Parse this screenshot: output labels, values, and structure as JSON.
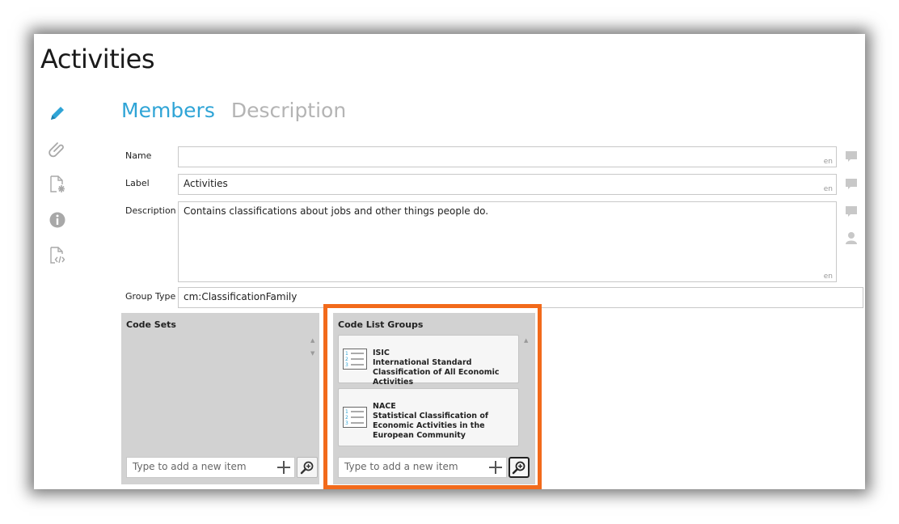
{
  "page": {
    "title": "Activities"
  },
  "sidebar": {
    "icons": [
      "pencil-icon",
      "paperclip-icon",
      "document-asterisk-icon",
      "info-icon",
      "document-code-icon"
    ]
  },
  "tabs": [
    {
      "label": "Members",
      "active": true
    },
    {
      "label": "Description",
      "active": false
    }
  ],
  "form": {
    "name": {
      "label": "Name",
      "value": "",
      "lang": "en"
    },
    "label": {
      "label": "Label",
      "value": "Activities",
      "lang": "en"
    },
    "description": {
      "label": "Description",
      "value": "Contains classifications about jobs and other things people do.",
      "lang": "en"
    },
    "group_type": {
      "label": "Group Type",
      "value": "cm:ClassificationFamily"
    }
  },
  "code_sets": {
    "title": "Code Sets",
    "items": [],
    "add_placeholder": "Type to add a new item"
  },
  "code_list_groups": {
    "title": "Code List Groups",
    "items": [
      {
        "code": "ISIC",
        "name": "International Standard Classification of All Economic Activities"
      },
      {
        "code": "NACE",
        "name": "Statistical Classification of Economic Activities in the European Community"
      }
    ],
    "add_placeholder": "Type to add a new item"
  },
  "colors": {
    "accent": "#2fa4d6",
    "inactive_tab": "#b4b4b4",
    "panel_bg": "#d2d2d2",
    "highlight": "#f26a1b"
  }
}
